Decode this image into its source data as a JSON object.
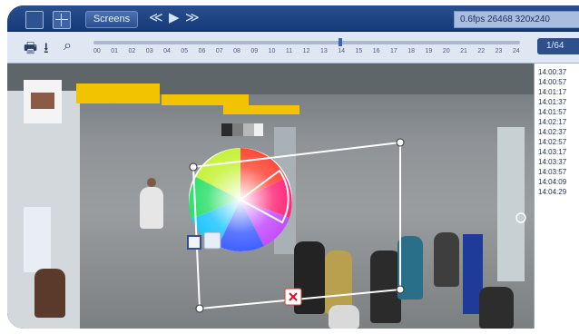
{
  "toolbar": {
    "screens_label": "Screens",
    "nav_prev": "≪",
    "nav_play": "▶",
    "nav_next": "≫",
    "status_text": "0.6fps 26468 320x240",
    "page_indicator": "1/64",
    "timeline_hours": [
      "00",
      "01",
      "02",
      "03",
      "04",
      "05",
      "06",
      "07",
      "08",
      "09",
      "10",
      "11",
      "12",
      "13",
      "14",
      "15",
      "16",
      "17",
      "18",
      "19",
      "20",
      "21",
      "22",
      "23",
      "24"
    ]
  },
  "icons": {
    "window": "window-icon",
    "grid": "grid-icon",
    "print": "printer-icon",
    "download": "download-icon",
    "zoom": "magnifier-icon"
  },
  "sidebar": {
    "times": [
      "14:00:37",
      "14:00:57",
      "14:01:17",
      "14:01:37",
      "14:01:57",
      "14:02:17",
      "14:02:37",
      "14:02:57",
      "14:03:17",
      "14:03:37",
      "14:03:57",
      "14:04:09",
      "14:04:29"
    ]
  },
  "colors": {
    "accent": "#2b4f8f",
    "frame": "#163a78",
    "panel": "#dfe7f3",
    "marker": "#3c66b8"
  }
}
